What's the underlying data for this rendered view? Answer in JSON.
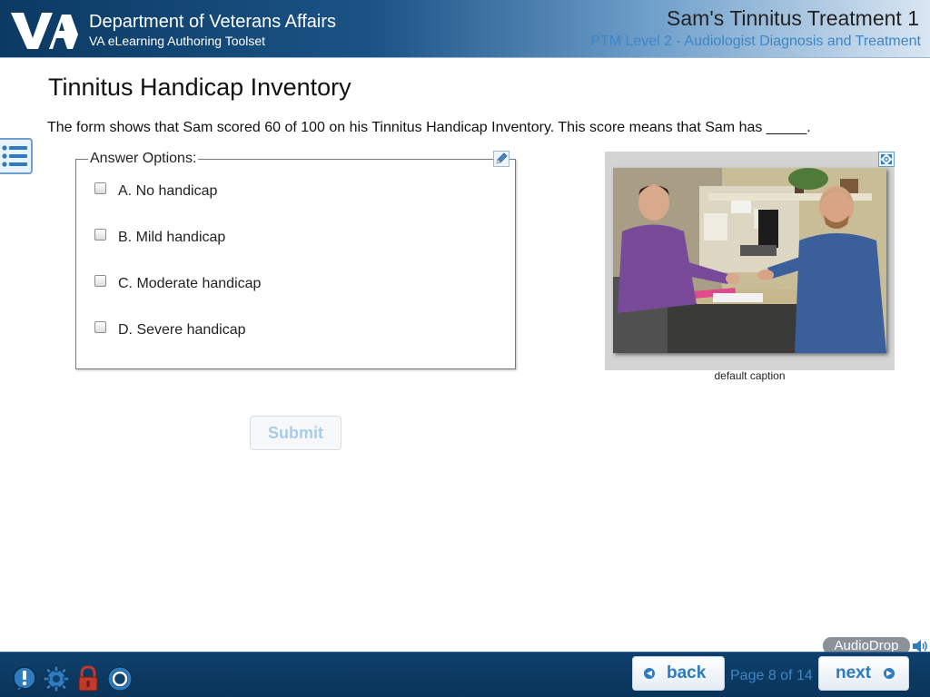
{
  "header": {
    "logo_text": "VA",
    "org_name": "Department of Veterans Affairs",
    "org_sub": "VA eLearning Authoring Toolset",
    "course_title": "Sam's Tinnitus Treatment 1",
    "course_sub": "PTM Level 2 - Audiologist Diagnosis and Treatment"
  },
  "page": {
    "title": "Tinnitus Handicap Inventory",
    "question": "The form shows that Sam scored 60 of 100 on his Tinnitus Handicap Inventory. This score means that Sam has _____."
  },
  "answers": {
    "legend": "Answer Options:",
    "options": [
      {
        "label": "A. No handicap"
      },
      {
        "label": "B. Mild handicap"
      },
      {
        "label": "C. Moderate handicap"
      },
      {
        "label": "D. Severe handicap"
      }
    ]
  },
  "submit_label": "Submit",
  "media": {
    "caption": "default caption"
  },
  "footer": {
    "audiodrop_label": "AudioDrop",
    "back_label": "back",
    "next_label": "next",
    "page_count": "Page 8 of 14"
  },
  "icons": {
    "menu": "list-icon",
    "edit": "pencil-icon",
    "expand": "expand-icon",
    "audio": "speaker-icon",
    "help": "help-icon",
    "settings": "gear-icon",
    "lock": "lock-icon",
    "target": "target-icon"
  },
  "colors": {
    "header_dark": "#0b3a63",
    "accent_blue": "#2e7bbf",
    "footer_bg": "#0a3359",
    "lock_red": "#c0392b"
  }
}
